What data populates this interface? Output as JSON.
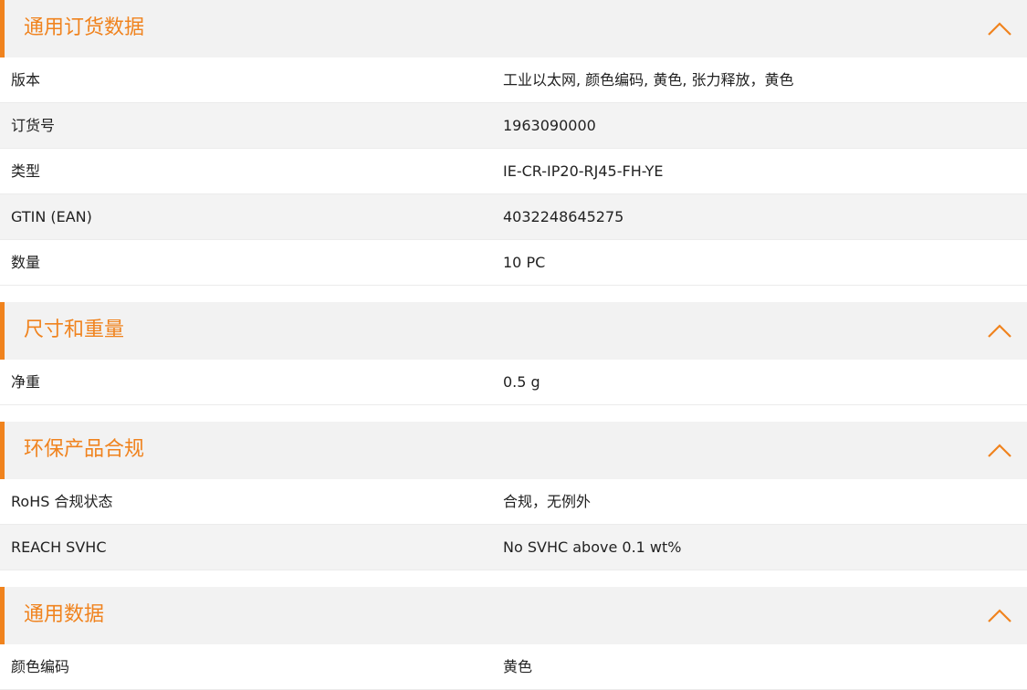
{
  "accent_color": "#f0831e",
  "sections": [
    {
      "title": "通用订货数据",
      "collapse_icon": "chevron-up-icon",
      "rows": [
        {
          "label": "版本",
          "value": "工业以太网, 颜色编码, 黄色, 张力释放，黄色"
        },
        {
          "label": "订货号",
          "value": "1963090000"
        },
        {
          "label": "类型",
          "value": "IE-CR-IP20-RJ45-FH-YE"
        },
        {
          "label": "GTIN (EAN)",
          "value": "4032248645275"
        },
        {
          "label": "数量",
          "value": "10  PC"
        }
      ]
    },
    {
      "title": "尺寸和重量",
      "collapse_icon": "chevron-up-icon",
      "rows": [
        {
          "label": "净重",
          "value": "0.5  g"
        }
      ]
    },
    {
      "title": "环保产品合规",
      "collapse_icon": "chevron-up-icon",
      "rows": [
        {
          "label": "RoHS 合规状态",
          "value": "合规，无例外"
        },
        {
          "label": "REACH SVHC",
          "value": "No SVHC above 0.1 wt%"
        }
      ]
    },
    {
      "title": "通用数据",
      "collapse_icon": "chevron-up-icon",
      "rows": [
        {
          "label": "颜色编码",
          "value": "黄色"
        }
      ]
    }
  ]
}
